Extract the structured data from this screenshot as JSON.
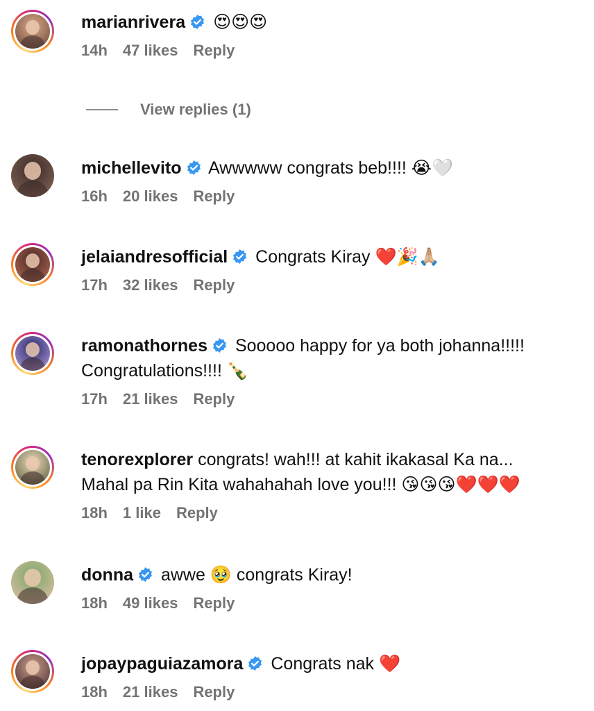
{
  "comments": [
    {
      "username": "marianrivera",
      "verified": true,
      "ring": true,
      "lines": [
        "😍😍😍"
      ],
      "time": "14h",
      "likes": "47 likes",
      "reply": "Reply",
      "avatar_colors": [
        "#d9a88a",
        "#6b4638"
      ]
    },
    {
      "username": "michellevito",
      "verified": true,
      "ring": false,
      "lines": [
        "Awwwww congrats beb!!!! 😭🤍"
      ],
      "time": "16h",
      "likes": "20 likes",
      "reply": "Reply",
      "avatar_colors": [
        "#3a2a28",
        "#8a6a5a"
      ]
    },
    {
      "username": "jelaiandresofficial",
      "verified": true,
      "ring": true,
      "lines": [
        "Congrats Kiray ❤️🎉🙏🏼"
      ],
      "time": "17h",
      "likes": "32 likes",
      "reply": "Reply",
      "avatar_colors": [
        "#4a2a2a",
        "#b86a50"
      ]
    },
    {
      "username": "ramonathornes",
      "verified": true,
      "ring": true,
      "lines": [
        "Sooooo happy for ya both johanna!!!!!",
        "Congratulations!!!! 🍾"
      ],
      "time": "17h",
      "likes": "21 likes",
      "reply": "Reply",
      "avatar_colors": [
        "#2a2a6a",
        "#b8a0e0"
      ]
    },
    {
      "username": "tenorexplorer",
      "verified": false,
      "ring": true,
      "lines": [
        "congrats! wah!!! at kahit ikakasal Ka na...",
        "Mahal pa Rin Kita wahahahah love you!!! 😘😘😘❤️❤️❤️"
      ],
      "time": "18h",
      "likes": "1 like",
      "reply": "Reply",
      "avatar_colors": [
        "#e8d8b8",
        "#5a5a3a"
      ]
    },
    {
      "username": "donna",
      "verified": true,
      "ring": false,
      "lines": [
        "awwe 🥹 congrats Kiray!"
      ],
      "time": "18h",
      "likes": "49 likes",
      "reply": "Reply",
      "avatar_colors": [
        "#7aa86a",
        "#e8c0a8"
      ]
    },
    {
      "username": "jopaypaguiazamora",
      "verified": true,
      "ring": true,
      "lines": [
        "Congrats nak ❤️"
      ],
      "time": "18h",
      "likes": "21 likes",
      "reply": "Reply",
      "avatar_colors": [
        "#c89a8a",
        "#4a3030"
      ]
    }
  ],
  "view_replies": "View replies (1)",
  "accent_verified": "#3897f0"
}
